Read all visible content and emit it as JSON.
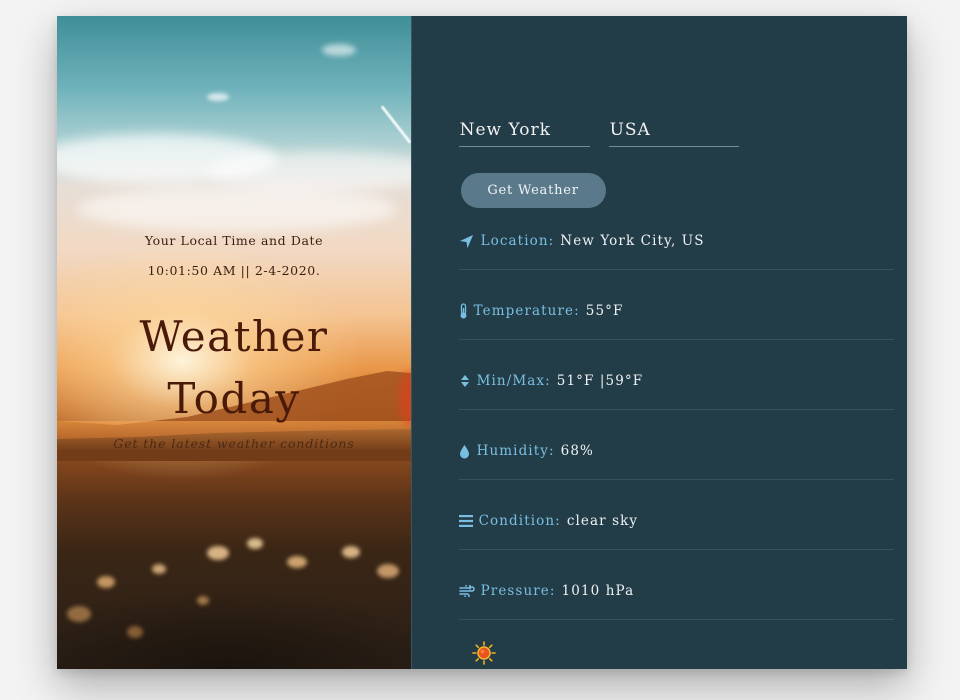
{
  "hero": {
    "local_label": "Your Local Time and Date",
    "local_datetime": "10:01:50 AM || 2-4-2020.",
    "title_line1": "Weather",
    "title_line2": "Today",
    "subtitle": "Get the latest weather conditions"
  },
  "search": {
    "city_value": "New York",
    "country_value": "USA",
    "button_label": "Get Weather"
  },
  "details": [
    {
      "icon": "location-arrow-icon",
      "label": "Location:",
      "value": "New York City, US"
    },
    {
      "icon": "thermometer-icon",
      "label": "Temperature:",
      "value": "55°F"
    },
    {
      "icon": "sort-arrows-icon",
      "label": "Min/Max:",
      "value": "51°F |59°F"
    },
    {
      "icon": "water-drop-icon",
      "label": "Humidity:",
      "value": "68%"
    },
    {
      "icon": "list-lines-icon",
      "label": "Condition:",
      "value": "clear sky"
    },
    {
      "icon": "wind-icon",
      "label": "Pressure:",
      "value": "1010 hPa"
    }
  ],
  "condition_icon": "sun-icon",
  "colors": {
    "panel_bg": "#233d48",
    "label_accent": "#79bfe2",
    "button_bg": "#5a7a8c",
    "hero_title": "#4a1a08"
  }
}
